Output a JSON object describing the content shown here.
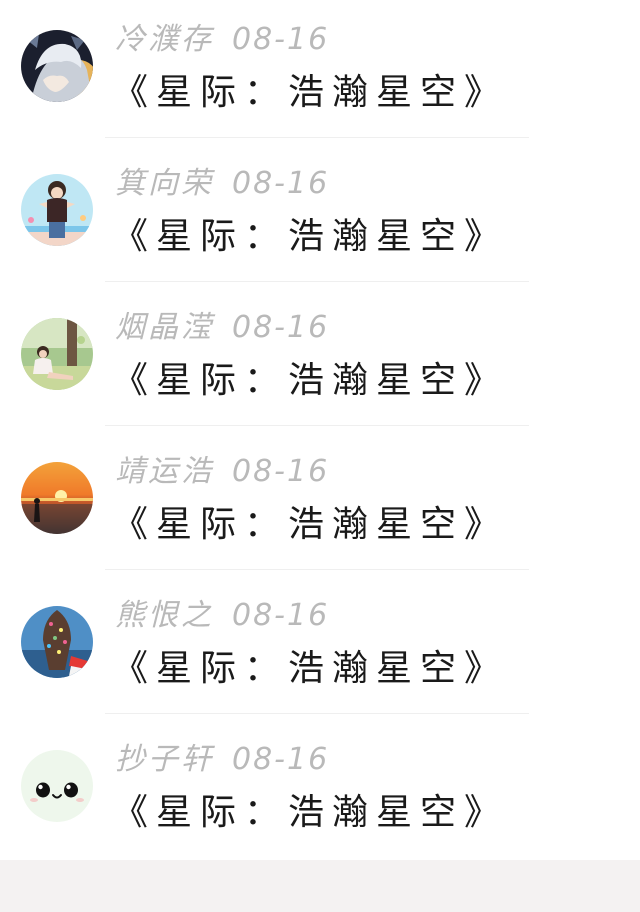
{
  "comments": [
    {
      "name": "冷濮存",
      "date": "08-16",
      "title": "《星际：浩瀚星空》",
      "avatar": "anime-boy-avatar"
    },
    {
      "name": "箕向荣",
      "date": "08-16",
      "title": "《星际：浩瀚星空》",
      "avatar": "anime-girl-avatar"
    },
    {
      "name": "烟晶滢",
      "date": "08-16",
      "title": "《星际：浩瀚星空》",
      "avatar": "girl-sitting-avatar"
    },
    {
      "name": "靖运浩",
      "date": "08-16",
      "title": "《星际：浩瀚星空》",
      "avatar": "sunset-avatar"
    },
    {
      "name": "熊恨之",
      "date": "08-16",
      "title": "《星际：浩瀚星空》",
      "avatar": "ice-cream-avatar"
    },
    {
      "name": "抄子轩",
      "date": "08-16",
      "title": "《星际：浩瀚星空》",
      "avatar": "smiley-face-avatar"
    }
  ],
  "colors": {
    "meta_text": "#b9b9b9",
    "title_text": "#1a1a1a",
    "divider": "#efefef",
    "footer_bg": "#f4f2f2"
  }
}
